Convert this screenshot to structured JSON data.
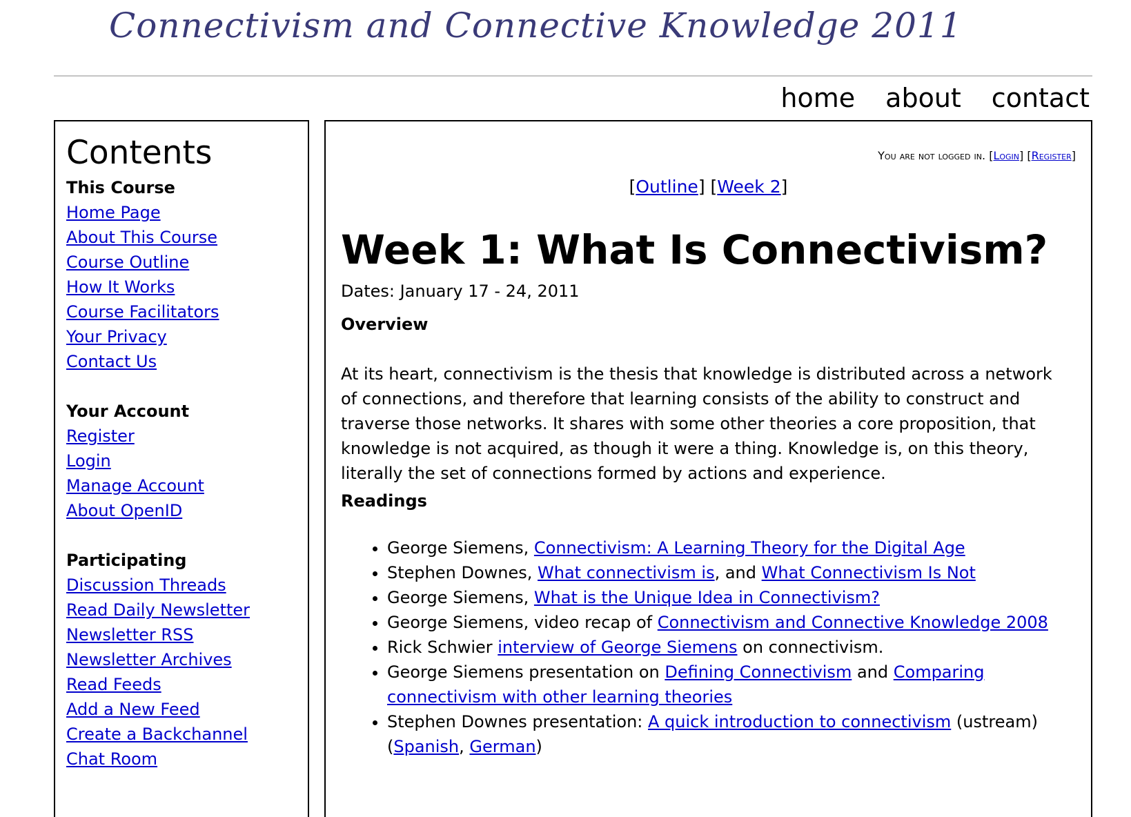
{
  "header": {
    "banner": "Connectivism and Connective Knowledge 2011",
    "nav": [
      "home",
      "about",
      "contact"
    ]
  },
  "sidebar": {
    "title": "Contents",
    "sections": [
      {
        "title": "This Course",
        "links": [
          "Home Page",
          "About This Course",
          "Course Outline",
          "How It Works",
          "Course Facilitators",
          "Your Privacy",
          "Contact Us"
        ]
      },
      {
        "title": "Your Account",
        "links": [
          "Register",
          "Login",
          "Manage Account",
          "About OpenID"
        ]
      },
      {
        "title": "Participating",
        "links": [
          "Discussion Threads",
          "Read Daily Newsletter",
          "Newsletter RSS",
          "Newsletter Archives",
          "Read Feeds",
          "Add a New Feed",
          "Create a Backchannel",
          "Chat Room"
        ]
      }
    ]
  },
  "main": {
    "login": {
      "status": "You are not logged in.",
      "login": "Login",
      "register": "Register"
    },
    "pager": {
      "outline": "Outline",
      "next": "Week 2"
    },
    "title": "Week 1: What Is Connectivism?",
    "dates": "Dates: January 17 - 24, 2011",
    "overview_heading": "Overview",
    "overview": "At its heart, connectivism is the thesis that knowledge is distributed across a network of connections, and therefore that learning consists of the ability to construct and traverse those networks. It shares with some other theories a core proposition, that knowledge is not acquired, as though it were a thing. Knowledge is, on this theory, literally the set of connections formed by actions and experience.",
    "readings_heading": "Readings",
    "readings": [
      {
        "prefix": "George Siemens, ",
        "link1": "Connectivism: A Learning Theory for the Digital Age"
      },
      {
        "prefix": "Stephen Downes, ",
        "link1": "What connectivism is",
        "mid": ", and ",
        "link2": "What Connectivism Is Not"
      },
      {
        "prefix": "George Siemens, ",
        "link1": "What is the Unique Idea in Connectivism?"
      },
      {
        "prefix": "George Siemens, video recap of ",
        "link1": "Connectivism and Connective Knowledge 2008"
      },
      {
        "prefix": "Rick Schwier ",
        "link1": "interview of George Siemens",
        "suffix": " on connectivism."
      },
      {
        "prefix": "George Siemens presentation on ",
        "link1": "Defining Connectivism",
        "mid": " and ",
        "link2": "Comparing connectivism with other learning theories"
      },
      {
        "prefix": "Stephen Downes presentation: ",
        "link1": "A quick introduction to connectivism",
        "mid": " (ustream) (",
        "link2": "Spanish",
        "mid2": ", ",
        "link3": "German",
        "suffix": ")"
      }
    ]
  }
}
